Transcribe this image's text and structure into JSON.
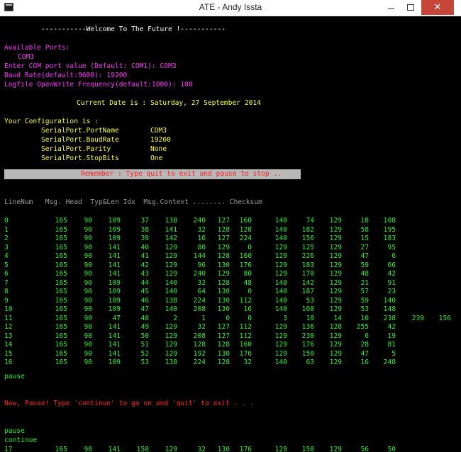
{
  "window": {
    "title": "ATE - Andy Issta",
    "minimize_glyph": "",
    "maximize_glyph": "",
    "close_glyph": "✕",
    "icon": "console-app-icon"
  },
  "colors": {
    "background": "#000000",
    "magenta": "#ff37ff",
    "yellow": "#ffff3c",
    "green": "#2df02d",
    "gray": "#9a9a9a",
    "red": "#ff2a2a",
    "banner_bg": "#b8b8b8",
    "close_button": "#c7463a"
  },
  "console": {
    "welcome": "-----------Welcome To The Future !-----------",
    "available_ports_label": "Available Ports:",
    "port_listed": "COM3",
    "com_prompt": "Enter COM port value (Default: COM1): COM3",
    "baud_prompt": "Baud Rate(default:9600): 19200",
    "logfile_prompt": "Logfile OpenWrite Frequency(default:1000): 100",
    "current_date": "Current Date is : Saturday, 27 September 2014",
    "config_header": "Your Configuration is :",
    "config": [
      {
        "key": "SerialPort.PortName",
        "value": "COM3"
      },
      {
        "key": "SerialPort.BaudRate",
        "value": "19200"
      },
      {
        "key": "SerialPort.Parity",
        "value": "None"
      },
      {
        "key": "SerialPort.StopBits",
        "value": "One"
      }
    ],
    "remember": "Remember : Type quit to exit and pause to stop ..",
    "table_header": "LineNum   Msg. Head  Typ&Len Idx  Msg.Context ........ Checksum",
    "rows": [
      [
        "0",
        "165",
        "90",
        "109",
        "37",
        "138",
        "240",
        "127",
        "160",
        "140",
        "74",
        "129",
        "18",
        "108"
      ],
      [
        "1",
        "165",
        "90",
        "109",
        "38",
        "141",
        "32",
        "128",
        "128",
        "140",
        "182",
        "129",
        "58",
        "195"
      ],
      [
        "2",
        "165",
        "90",
        "109",
        "39",
        "142",
        "16",
        "127",
        "224",
        "140",
        "156",
        "129",
        "15",
        "183"
      ],
      [
        "3",
        "165",
        "90",
        "141",
        "40",
        "129",
        "80",
        "129",
        "0",
        "129",
        "125",
        "129",
        "27",
        "95"
      ],
      [
        "4",
        "165",
        "90",
        "141",
        "41",
        "129",
        "144",
        "128",
        "160",
        "129",
        "226",
        "129",
        "47",
        "6"
      ],
      [
        "5",
        "165",
        "90",
        "141",
        "42",
        "129",
        "96",
        "130",
        "176",
        "129",
        "183",
        "129",
        "59",
        "66"
      ],
      [
        "6",
        "165",
        "90",
        "141",
        "43",
        "129",
        "240",
        "129",
        "80",
        "129",
        "170",
        "129",
        "48",
        "42"
      ],
      [
        "7",
        "165",
        "90",
        "109",
        "44",
        "140",
        "32",
        "128",
        "48",
        "140",
        "142",
        "129",
        "21",
        "91"
      ],
      [
        "8",
        "165",
        "90",
        "109",
        "45",
        "140",
        "64",
        "130",
        "0",
        "140",
        "187",
        "129",
        "57",
        "23"
      ],
      [
        "9",
        "165",
        "90",
        "109",
        "46",
        "138",
        "224",
        "130",
        "112",
        "140",
        "53",
        "129",
        "59",
        "140"
      ],
      [
        "10",
        "165",
        "90",
        "109",
        "47",
        "140",
        "208",
        "130",
        "16",
        "140",
        "160",
        "129",
        "53",
        "148"
      ],
      [
        "11",
        "165",
        "90",
        "47",
        "48",
        "2",
        "1",
        "0",
        "0",
        "3",
        "10",
        "14",
        "10",
        "238",
        "239",
        "156"
      ],
      [
        "12",
        "165",
        "90",
        "141",
        "49",
        "129",
        "32",
        "127",
        "112",
        "129",
        "136",
        "128",
        "255",
        "42"
      ],
      [
        "13",
        "165",
        "90",
        "141",
        "50",
        "129",
        "208",
        "127",
        "112",
        "129",
        "230",
        "129",
        "6",
        "19"
      ],
      [
        "14",
        "165",
        "90",
        "141",
        "51",
        "129",
        "128",
        "128",
        "160",
        "129",
        "176",
        "129",
        "28",
        "81"
      ],
      [
        "15",
        "165",
        "90",
        "141",
        "52",
        "129",
        "192",
        "130",
        "176",
        "129",
        "150",
        "129",
        "47",
        "5"
      ],
      [
        "16",
        "165",
        "90",
        "109",
        "53",
        "138",
        "224",
        "128",
        "32",
        "140",
        "63",
        "129",
        "16",
        "248"
      ]
    ],
    "pause1": "pause",
    "pause_msg": "Now, Pause! Type 'continue' to go on and 'quit' to exit . . .",
    "pause2": "pause",
    "continue_cmd": "continue",
    "last_row": [
      "17",
      "165",
      "90",
      "141",
      "158",
      "129",
      "32",
      "130",
      "176",
      "129",
      "150",
      "129",
      "56",
      "50"
    ]
  }
}
